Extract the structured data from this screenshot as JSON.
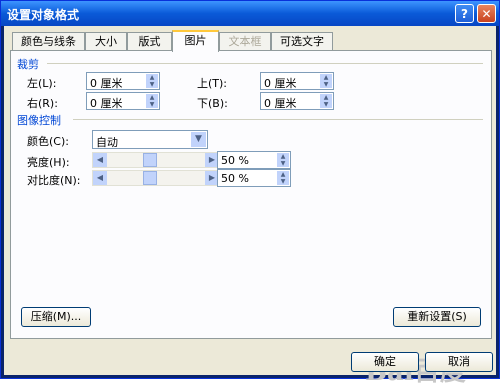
{
  "window": {
    "title": "设置对象格式",
    "help": "?",
    "close": "✕"
  },
  "tabs": [
    {
      "label": "颜色与线条"
    },
    {
      "label": "大小"
    },
    {
      "label": "版式"
    },
    {
      "label": "图片"
    },
    {
      "label": "文本框"
    },
    {
      "label": "可选文字"
    }
  ],
  "crop": {
    "title": "裁剪",
    "left_label": "左(L):",
    "left_value": "0 厘米",
    "right_label": "右(R):",
    "right_value": "0 厘米",
    "top_label": "上(T):",
    "top_value": "0 厘米",
    "bottom_label": "下(B):",
    "bottom_value": "0 厘米"
  },
  "image_control": {
    "title": "图像控制",
    "color_label": "颜色(C):",
    "color_value": "自动",
    "brightness_label": "亮度(H):",
    "brightness_value": "50 %",
    "contrast_label": "对比度(N):",
    "contrast_value": "50 %"
  },
  "buttons": {
    "compress": "压缩(M)...",
    "reset": "重新设置(S)",
    "ok": "确定",
    "cancel": "取消"
  },
  "watermark": "Bai百度"
}
